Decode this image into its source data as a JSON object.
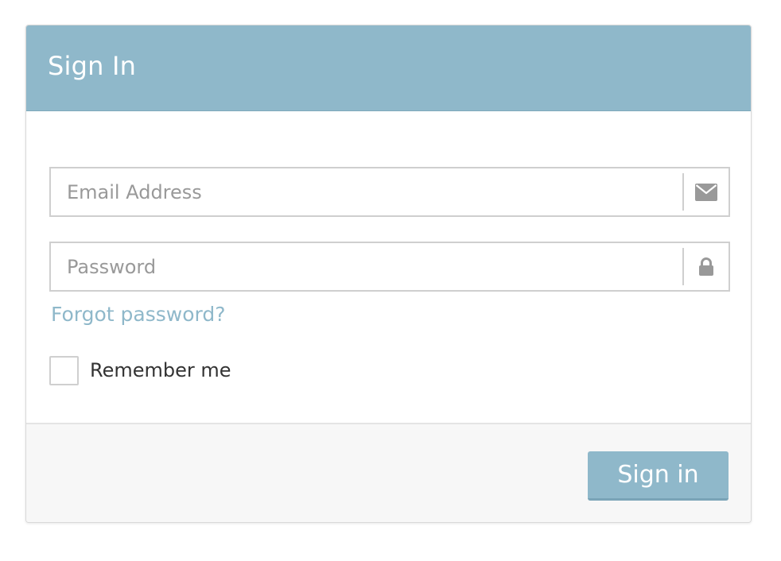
{
  "header": {
    "title": "Sign In"
  },
  "form": {
    "email": {
      "placeholder": "Email Address",
      "value": "",
      "icon": "envelope-icon"
    },
    "password": {
      "placeholder": "Password",
      "value": "",
      "icon": "lock-icon"
    },
    "forgot_label": "Forgot password?",
    "remember_label": "Remember me",
    "remember_checked": false
  },
  "footer": {
    "signin_label": "Sign in"
  },
  "colors": {
    "accent": "#8fb8ca",
    "icon": "#999999",
    "border": "#cfcfcf",
    "footer_bg": "#f7f7f7"
  }
}
